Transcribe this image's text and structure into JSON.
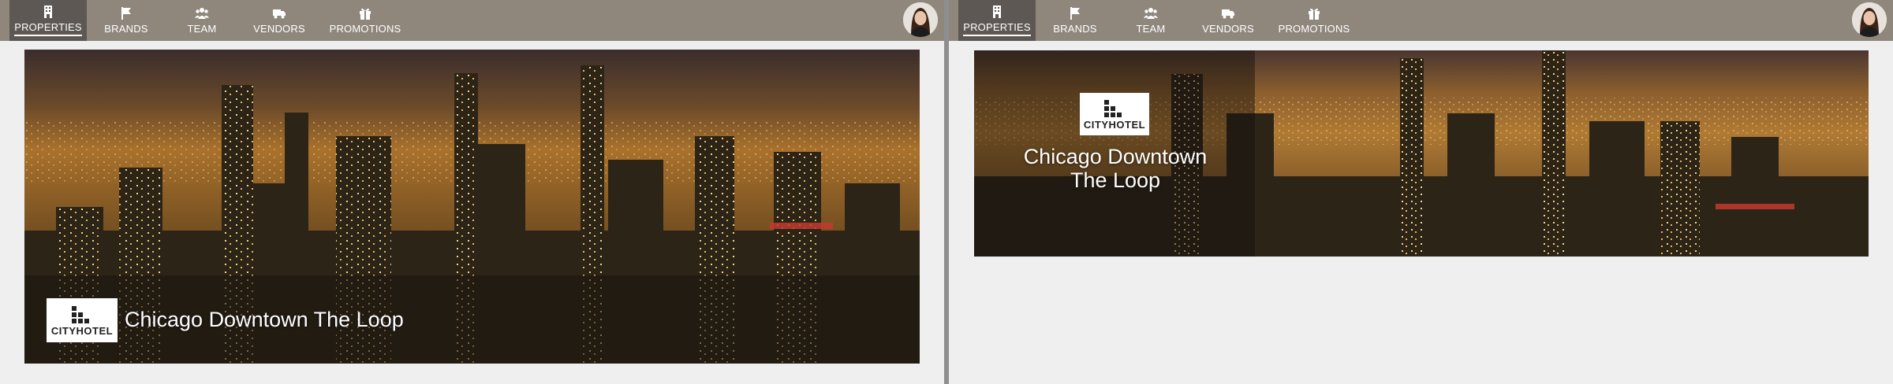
{
  "nav": {
    "items": [
      {
        "label": "PROPERTIES",
        "icon": "building-icon",
        "active": true
      },
      {
        "label": "BRANDS",
        "icon": "flag-icon"
      },
      {
        "label": "TEAM",
        "icon": "team-icon"
      },
      {
        "label": "VENDORS",
        "icon": "truck-icon"
      },
      {
        "label": "PROMOTIONS",
        "icon": "gift-icon"
      }
    ]
  },
  "user": {
    "avatar": "user-avatar"
  },
  "property": {
    "name": "Chicago Downtown The Loop",
    "name_line1": "Chicago Downtown",
    "name_line2": "The Loop",
    "brand": "CITYHOTEL"
  },
  "colors": {
    "nav_bg": "#8f877c",
    "nav_active": "#5d5853",
    "page_bg": "#efefef"
  }
}
